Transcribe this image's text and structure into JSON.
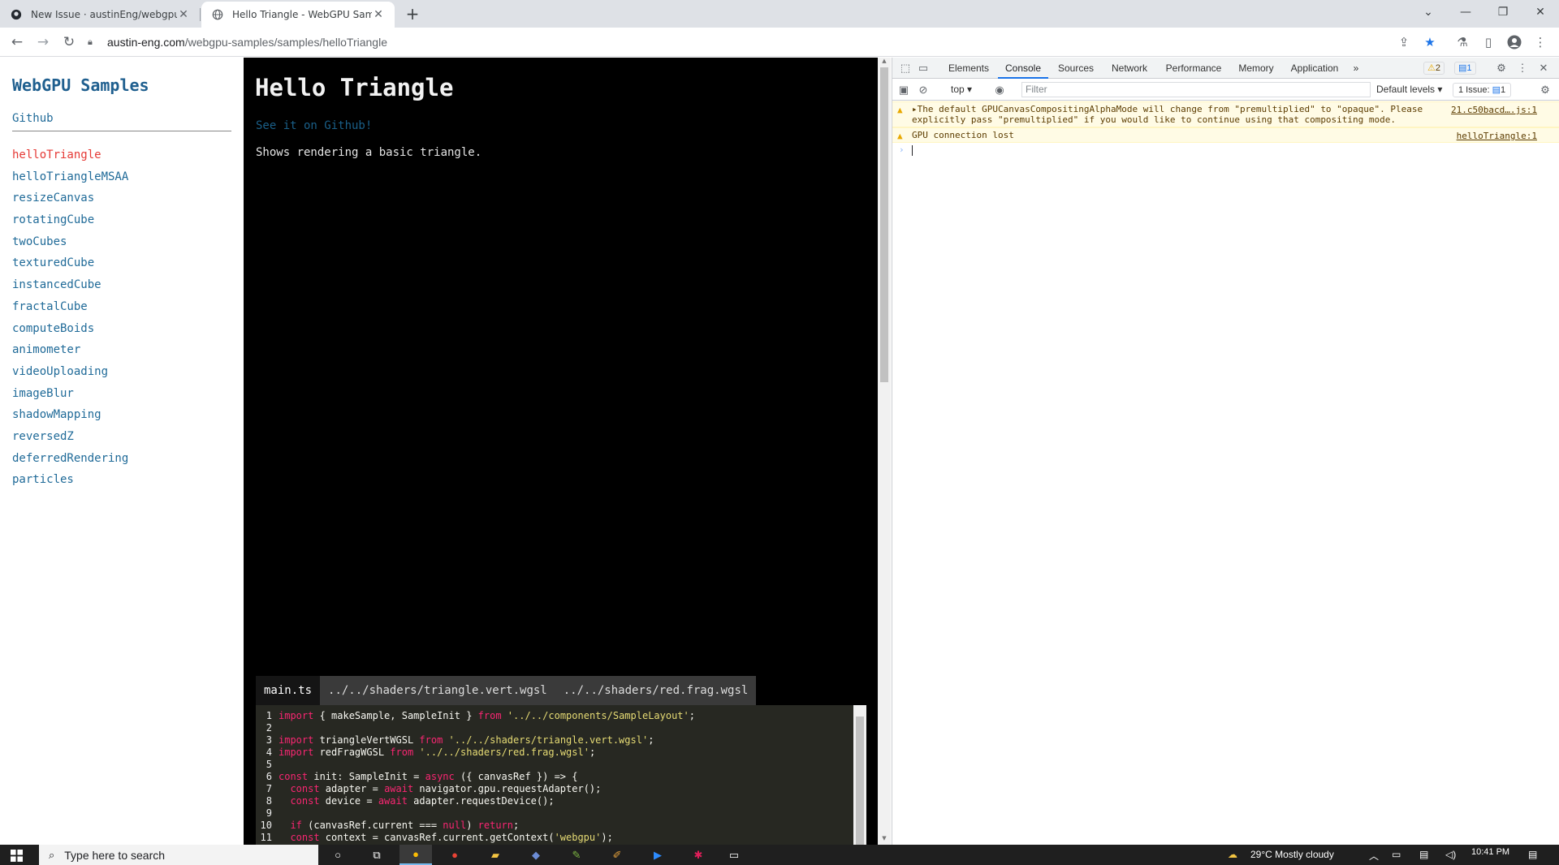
{
  "browser": {
    "tabs": [
      {
        "title": "New Issue · austinEng/webgpu-s",
        "icon": "github-icon",
        "active": false
      },
      {
        "title": "Hello Triangle - WebGPU Sample",
        "icon": "globe-icon",
        "active": true
      }
    ],
    "new_tab": "+",
    "url_host": "austin-eng.com",
    "url_path": "/webgpu-samples/samples/helloTriangle"
  },
  "sidebar": {
    "title": "WebGPU Samples",
    "github": "Github",
    "items": [
      {
        "label": "helloTriangle",
        "active": true
      },
      {
        "label": "helloTriangleMSAA"
      },
      {
        "label": "resizeCanvas"
      },
      {
        "label": "rotatingCube"
      },
      {
        "label": "twoCubes"
      },
      {
        "label": "texturedCube"
      },
      {
        "label": "instancedCube"
      },
      {
        "label": "fractalCube"
      },
      {
        "label": "computeBoids"
      },
      {
        "label": "animometer"
      },
      {
        "label": "videoUploading"
      },
      {
        "label": "imageBlur"
      },
      {
        "label": "shadowMapping"
      },
      {
        "label": "reversedZ"
      },
      {
        "label": "deferredRendering"
      },
      {
        "label": "particles"
      }
    ]
  },
  "main": {
    "title": "Hello Triangle",
    "github_link": "See it on Github!",
    "description": "Shows rendering a basic triangle.",
    "code_tabs": [
      {
        "label": "main.ts",
        "active": true
      },
      {
        "label": "../../shaders/triangle.vert.wgsl"
      },
      {
        "label": "../../shaders/red.frag.wgsl"
      }
    ],
    "code_lines": [
      "import { makeSample, SampleInit } from '../../components/SampleLayout';",
      "",
      "import triangleVertWGSL from '../../shaders/triangle.vert.wgsl';",
      "import redFragWGSL from '../../shaders/red.frag.wgsl';",
      "",
      "const init: SampleInit = async ({ canvasRef }) => {",
      "  const adapter = await navigator.gpu.requestAdapter();",
      "  const device = await adapter.requestDevice();",
      "",
      "  if (canvasRef.current === null) return;",
      "  const context = canvasRef.current.getContext('webgpu');"
    ]
  },
  "devtools": {
    "tabs": [
      "Elements",
      "Console",
      "Sources",
      "Network",
      "Performance",
      "Memory",
      "Application"
    ],
    "active_tab": "Console",
    "more": "»",
    "warn_count": "2",
    "info_count": "1",
    "context": "top ▾",
    "filter_placeholder": "Filter",
    "levels": "Default levels ▾",
    "issues": "1 Issue:",
    "issues_count": "1",
    "messages": [
      {
        "level": "warning",
        "text": "▸The default GPUCanvasCompositingAlphaMode will change from \"premultiplied\" to \"opaque\". Please explicitly pass \"premultiplied\" if you would like to continue using that compositing mode.",
        "source": "21.c50bacd….js:1"
      },
      {
        "level": "warning",
        "text": "GPU connection lost",
        "source": "helloTriangle:1"
      }
    ],
    "prompt": "›"
  },
  "taskbar": {
    "search_placeholder": "Type here to search",
    "weather": "29°C  Mostly cloudy",
    "time": "10:41 PM"
  },
  "colors": {
    "link": "#1f6a98",
    "active_item": "#e53935",
    "warning_bg": "#fffbe5",
    "devtools_accent": "#1a73e8"
  }
}
